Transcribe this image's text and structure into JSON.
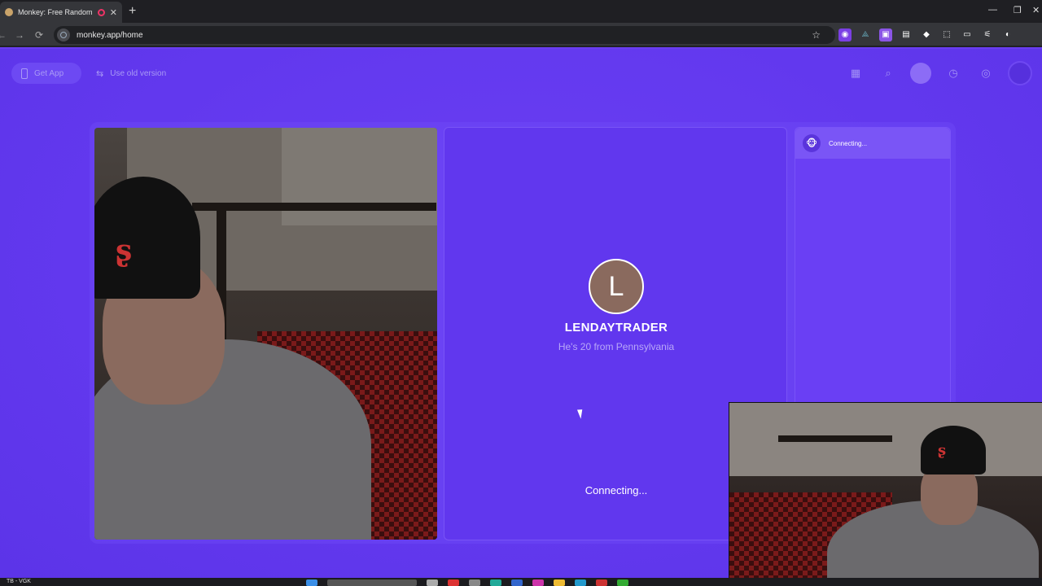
{
  "browser": {
    "tab_title": "Monkey: Free Random Vide",
    "tab_close": "✕",
    "new_tab": "+",
    "url": "monkey.app/home",
    "nav_back": "←",
    "nav_forward": "→",
    "nav_reload": "⟳",
    "star": "☆",
    "window_controls": [
      "—",
      "❐",
      "✕"
    ],
    "extensions": [
      "◉",
      "⟁",
      "▣",
      "▤",
      "◆",
      "⬚",
      "▭",
      "⚟",
      "◐"
    ]
  },
  "header": {
    "get_app_label": "Get App",
    "old_version_label": "Use old version",
    "swap_icon": "⇆",
    "nav_icons": [
      "▦",
      "⌕",
      "",
      "◷",
      "◎",
      ""
    ]
  },
  "match": {
    "avatar_letter": "L",
    "username": "LENDAYTRADER",
    "info": "He's 20 from Pennsylvania",
    "status": "Connecting..."
  },
  "chat": {
    "status": "Connecting...",
    "monkey_icon": "🐵"
  },
  "taskbar": {
    "label": "TB - VGK"
  },
  "colors": {
    "brand_purple": "#6238ee",
    "panel_purple": "#6137ee",
    "avatar_brown": "#8a6a5e"
  }
}
